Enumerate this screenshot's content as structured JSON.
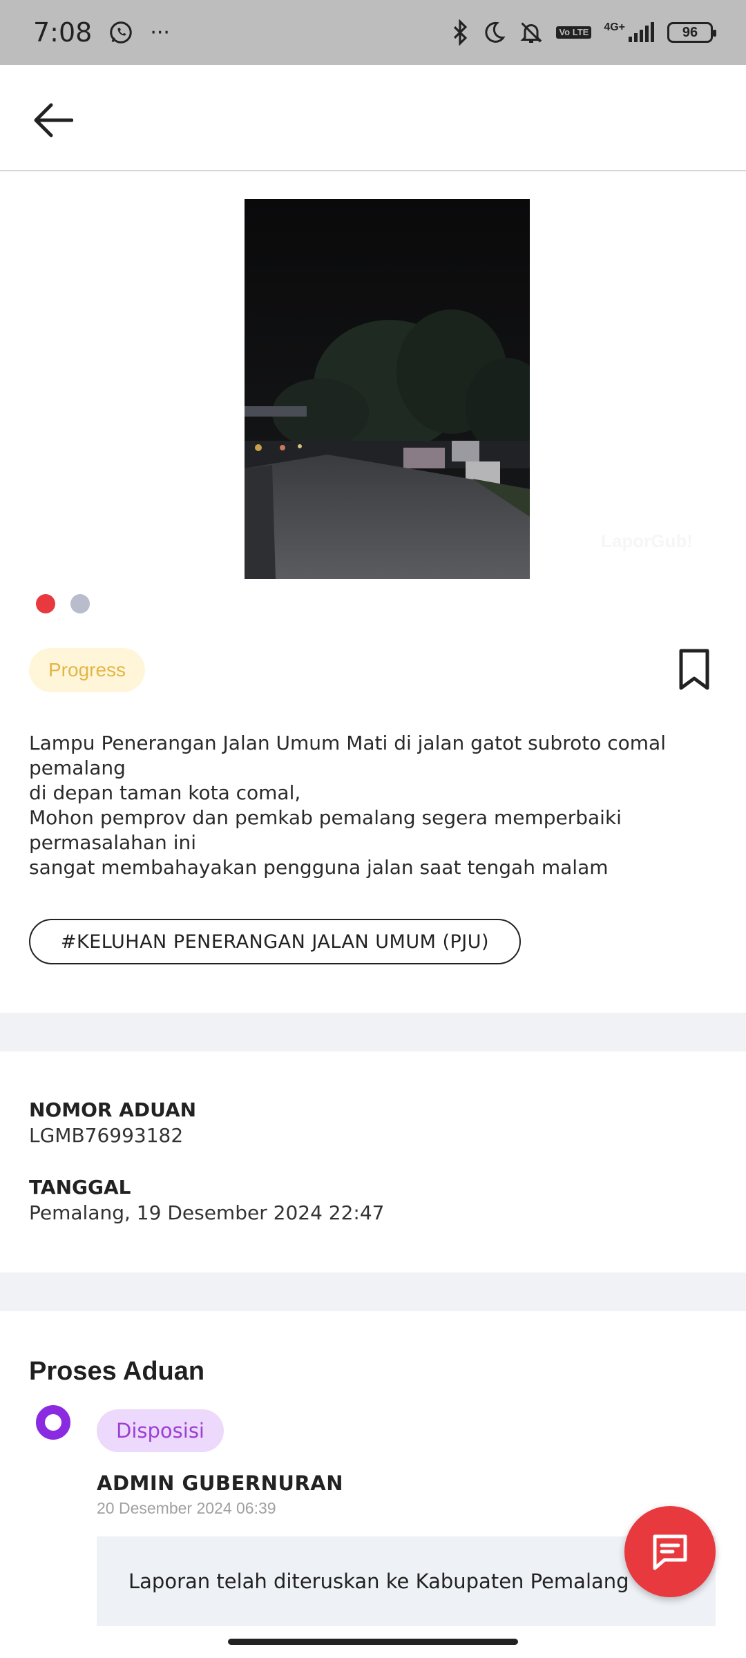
{
  "status_bar": {
    "time": "7:08",
    "more": "···",
    "network": "4G+",
    "volte": "Vo LTE",
    "battery": "96"
  },
  "report": {
    "image_watermark": "LaporGub!",
    "carousel_count": 2,
    "carousel_active": 0,
    "status": "Progress",
    "description": "Lampu Penerangan Jalan Umum Mati di jalan gatot subroto comal pemalang\ndi depan taman kota comal,\nMohon pemprov dan pemkab pemalang segera memperbaiki permasalahan ini\nsangat membahayakan pengguna jalan saat tengah malam",
    "tag": "#KELUHAN PENERANGAN JALAN UMUM (PJU)"
  },
  "details": {
    "nomor_label": "NOMOR ADUAN",
    "nomor_value": "LGMB76993182",
    "tanggal_label": "TANGGAL",
    "tanggal_value": "Pemalang, 19 Desember 2024 22:47"
  },
  "process": {
    "title": "Proses Aduan",
    "items": [
      {
        "status": "Disposisi",
        "actor": "ADMIN GUBERNURAN",
        "date": "20 Desember 2024 06:39",
        "message": "Laporan telah diteruskan ke Kabupaten Pemalang"
      }
    ]
  },
  "colors": {
    "accent_red": "#e8393f",
    "progress_bg": "#fff6d9",
    "progress_text": "#e3b545",
    "disposisi_bg": "#ecd9fb",
    "disposisi_text": "#9b40d6",
    "dot_inactive": "#b8bccb"
  },
  "icons": {
    "back": "arrow-left-icon",
    "bookmark": "bookmark-icon",
    "fab": "chat-icon"
  }
}
